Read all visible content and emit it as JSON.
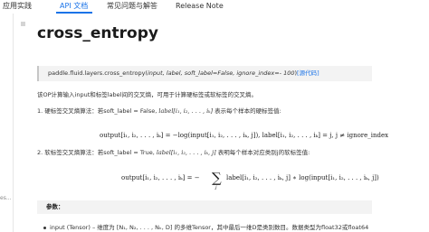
{
  "nav": {
    "items": [
      "应用实践",
      "API 文档",
      "常见问题与解答",
      "Release Note"
    ],
    "active_index": 1
  },
  "sidebar": {
    "partial_text": "es..."
  },
  "page": {
    "title": "cross_entropy",
    "signature": {
      "prefix": "paddle.fluid.layers.cross_entropy(",
      "args": "input, label, soft_label=False, ignore_index=- 100",
      "suffix": ")",
      "source_link": "[源代码]"
    },
    "intro": "该OP计算输入input和标签label间的交叉熵，可用于计算硬标签或软标签的交叉熵。",
    "item1": {
      "text_before": "1. 硬标签交叉熵算法：若soft_label = False, ",
      "math": "label[i₁, i₂, . . . , iₖ]",
      "text_after": " 表示每个样本的硬标签值:"
    },
    "formula1": "output[i₁, i₂, . . . , iₖ] = −log(input[i₁, i₂, . . . , iₖ, j]), label[i₁, i₂, . . . , iₖ] = j, j ≠ ignore_index",
    "item2": {
      "text_before": "2. 软标签交叉熵算法：若soft_label = True, ",
      "math": "label[i₁, i₂, . . . , iₖ, j]",
      "text_after": " 表明每个样本对应类别j的软标签值:"
    },
    "formula2": {
      "lhs": "output[i₁, i₂, . . . , iₖ] = −",
      "sum": "∑",
      "sub": "j",
      "rhs": "label[i₁, i₂, . . . , iₖ, j] ∗ log(input[i₁, i₂, . . . , iₖ, j])"
    },
    "params_title": "参数：",
    "param_input": "input (Tensor) – 维度为 [N₁, N₂, . . . , Nₖ, D] 的多维Tensor，其中最后一维D是类别数目。数据类型为float32或float64"
  }
}
